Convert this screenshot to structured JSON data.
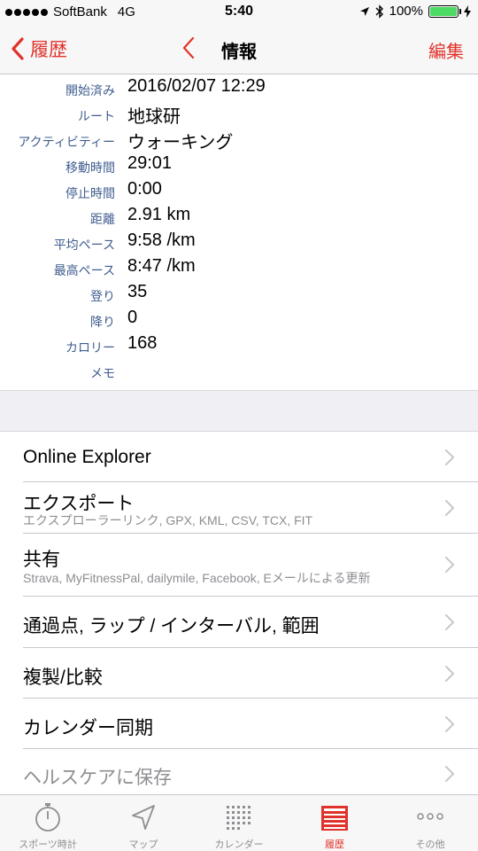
{
  "status_bar": {
    "carrier": "SoftBank",
    "network": "4G",
    "time": "5:40",
    "battery": "100%"
  },
  "nav": {
    "back_label": "履歴",
    "title": "情報",
    "edit_label": "編集"
  },
  "info": {
    "rows": [
      {
        "label": "開始済み",
        "value": "2016/02/07 12:29"
      },
      {
        "label": "ルート",
        "value": "地球研"
      },
      {
        "label": "アクティビティー",
        "value": "ウォーキング"
      },
      {
        "label": "移動時間",
        "value": "29:01"
      },
      {
        "label": "停止時間",
        "value": "0:00"
      },
      {
        "label": "距離",
        "value": "2.91 km"
      },
      {
        "label": "平均ペース",
        "value": "9:58 /km"
      },
      {
        "label": "最高ペース",
        "value": "8:47 /km"
      },
      {
        "label": "登り",
        "value": "35"
      },
      {
        "label": "降り",
        "value": "0"
      },
      {
        "label": "カロリー",
        "value": "168"
      },
      {
        "label": "メモ",
        "value": ""
      }
    ]
  },
  "menu": {
    "items": [
      {
        "title": "Online Explorer",
        "subtitle": ""
      },
      {
        "title": "エクスポート",
        "subtitle": "エクスプローラーリンク, GPX, KML, CSV, TCX, FIT"
      },
      {
        "title": "共有",
        "subtitle": "Strava, MyFitnessPal, dailymile, Facebook, Eメールによる更新"
      },
      {
        "title": "通過点, ラップ / インターバル, 範囲",
        "subtitle": ""
      },
      {
        "title": "複製/比較",
        "subtitle": ""
      },
      {
        "title": "カレンダー同期",
        "subtitle": ""
      },
      {
        "title": "ヘルスケアに保存",
        "subtitle": ""
      }
    ]
  },
  "tab_bar": {
    "tabs": [
      {
        "label": "スポーツ時計",
        "icon": "stopwatch-icon"
      },
      {
        "label": "マップ",
        "icon": "location-arrow-icon"
      },
      {
        "label": "カレンダー",
        "icon": "calendar-grid-icon"
      },
      {
        "label": "履歴",
        "icon": "history-list-icon"
      },
      {
        "label": "その他",
        "icon": "more-dots-icon"
      }
    ],
    "active_tab": "履歴"
  },
  "colors": {
    "accent": "#e0332b",
    "label_blue": "#3f5d8f",
    "battery_green": "#4cd964"
  }
}
